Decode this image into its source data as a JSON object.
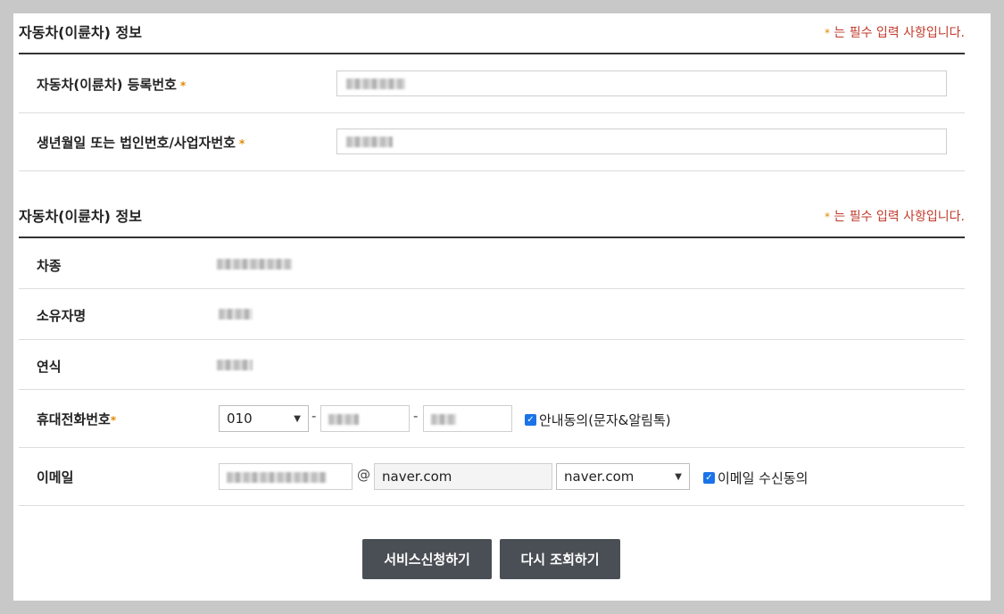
{
  "section1": {
    "title": "자동차(이륜차) 정보",
    "required_note_star": "*",
    "required_note": "는 필수 입력 사항입니다.",
    "fields": {
      "reg_number_label": "자동차(이륜차) 등록번호",
      "birth_label": "생년월일 또는 법인번호/사업자번호"
    }
  },
  "section2": {
    "title": "자동차(이륜차) 정보",
    "required_note_star": "*",
    "required_note": "는 필수 입력 사항입니다.",
    "rows": {
      "car_type_label": "차종",
      "owner_label": "소유자명",
      "year_label": "연식",
      "phone_label": "휴대전화번호",
      "email_label": "이메일"
    },
    "phone": {
      "prefix_selected": "010",
      "dash": "-",
      "consent_label": "안내동의(문자&알림톡)"
    },
    "email": {
      "at": "@",
      "domain_value": "naver.com",
      "domain_selected": "naver.com",
      "consent_label": "이메일 수신동의"
    }
  },
  "buttons": {
    "apply": "서비스신청하기",
    "requery": "다시 조회하기"
  },
  "colors": {
    "accent_required": "#c0392b",
    "star": "#e08a00",
    "button_bg": "#4a4f55",
    "checkbox": "#1a73e8"
  }
}
